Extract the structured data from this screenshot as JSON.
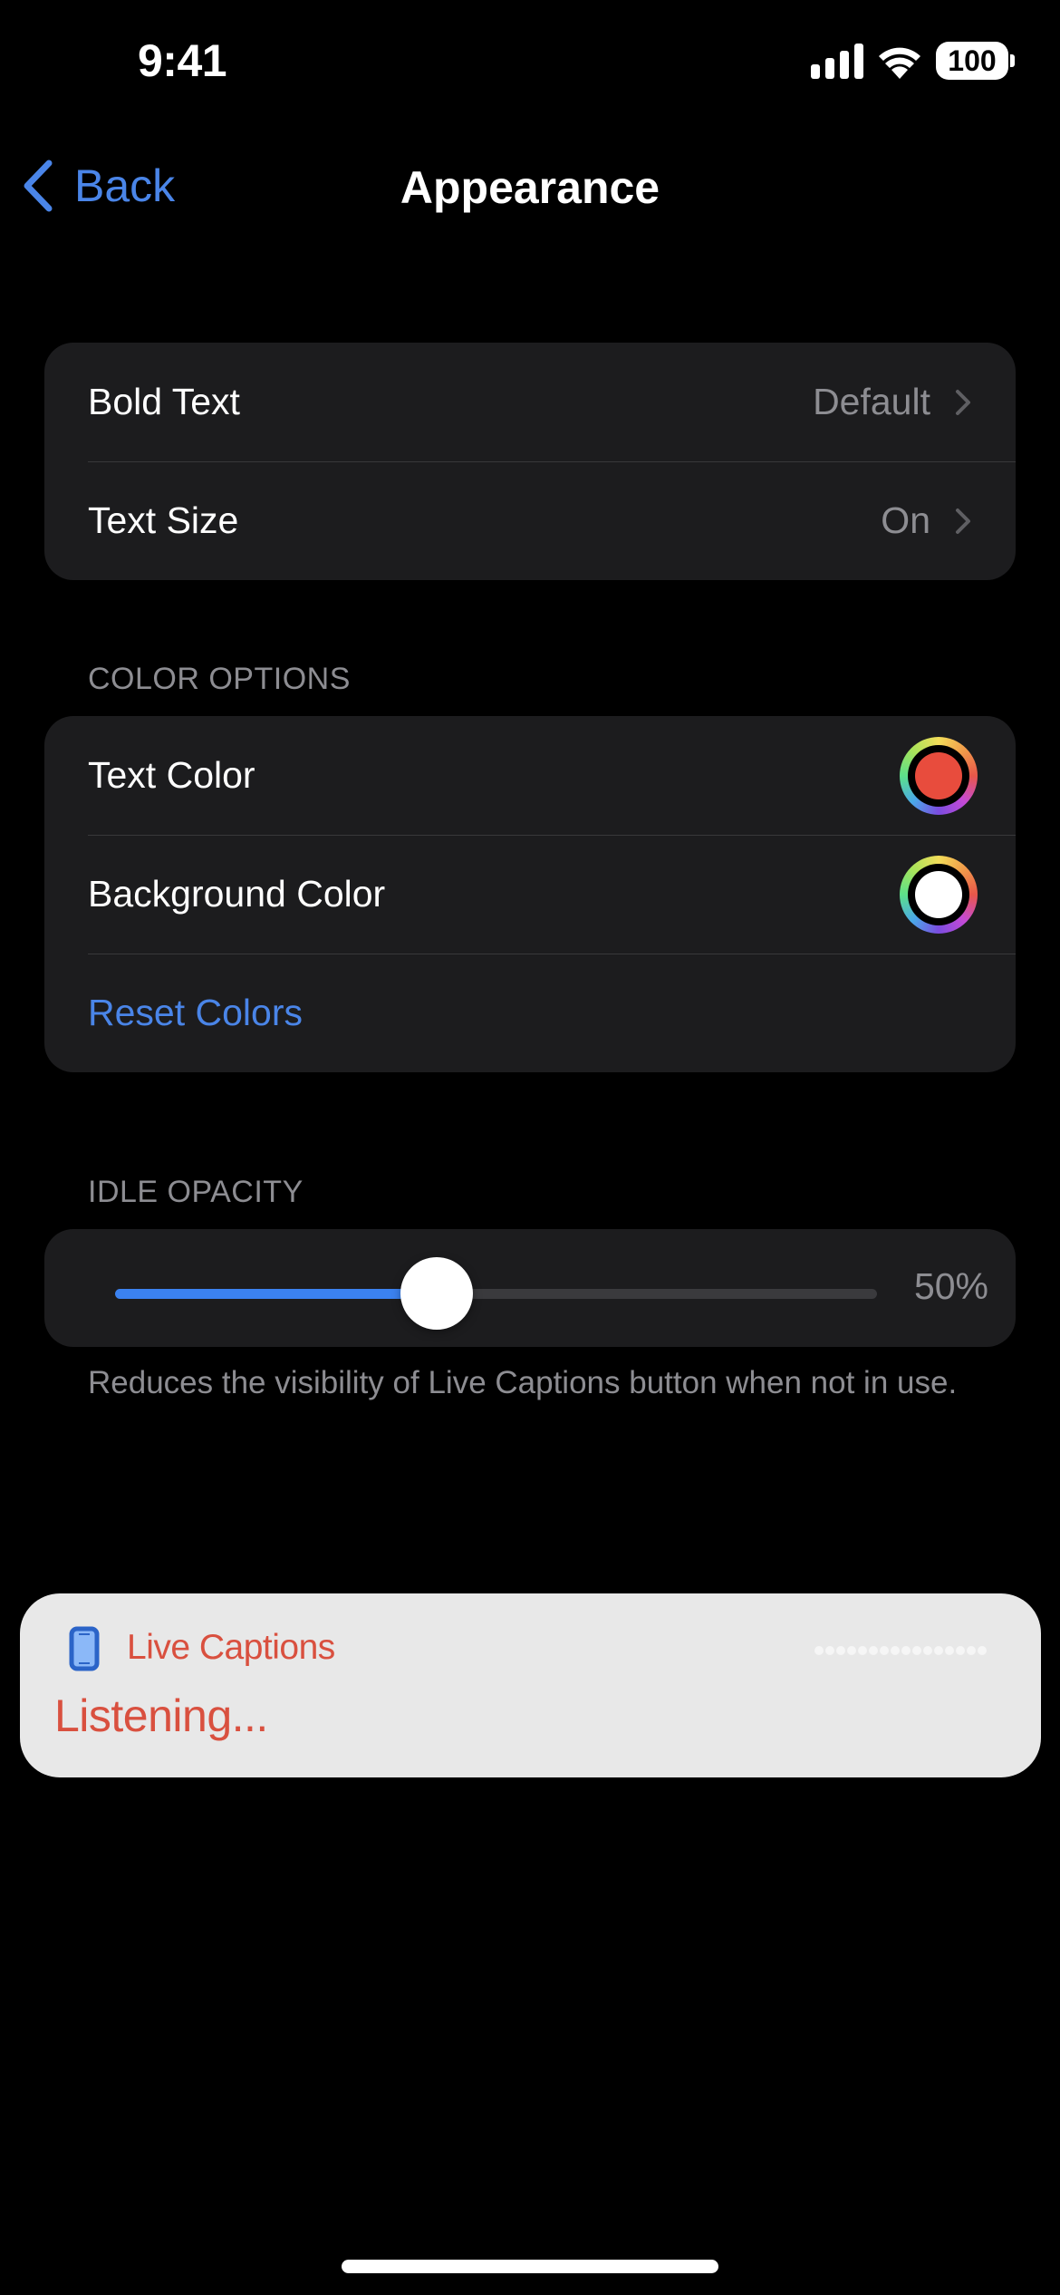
{
  "status_bar": {
    "time": "9:41",
    "battery_level": "100",
    "icons": [
      "cellular-signal-icon",
      "wifi-icon",
      "battery-icon"
    ]
  },
  "nav": {
    "back_label": "Back",
    "title": "Appearance"
  },
  "text_group": {
    "rows": [
      {
        "label": "Bold Text",
        "value": "Default"
      },
      {
        "label": "Text Size",
        "value": "On"
      }
    ]
  },
  "color_options": {
    "header": "COLOR OPTIONS",
    "rows": [
      {
        "label": "Text Color",
        "color": "#e84c3d"
      },
      {
        "label": "Background Color",
        "color": "#ffffff"
      }
    ],
    "reset_label": "Reset Colors"
  },
  "idle_opacity": {
    "header": "IDLE OPACITY",
    "value_label": "50%",
    "value_percent": 50,
    "footer": "Reduces the visibility of Live Captions button when not in use."
  },
  "live_captions": {
    "title": "Live Captions",
    "status": "Listening...",
    "accent_color": "#d9503f"
  },
  "colors": {
    "accent": "#4a85e8",
    "slider_fill": "#3b82f0",
    "background": "#000000",
    "card": "#1c1c1e",
    "secondary_text": "#8d8d92"
  }
}
